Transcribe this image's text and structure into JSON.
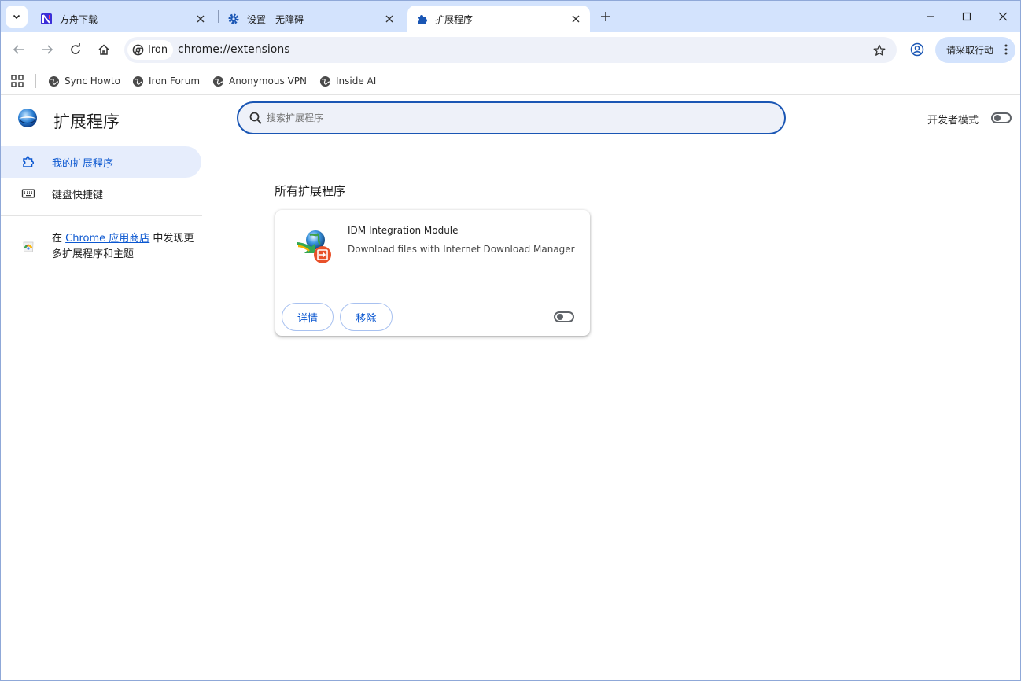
{
  "tabs": [
    {
      "title": "方舟下载",
      "icon": "site-logo-icon",
      "active": false
    },
    {
      "title": "设置 - 无障碍",
      "icon": "gear-icon",
      "active": false
    },
    {
      "title": "扩展程序",
      "icon": "puzzle-icon",
      "active": true
    }
  ],
  "toolbar": {
    "chip_label": "Iron",
    "url": "chrome://extensions",
    "action_label": "请采取行动"
  },
  "bookmarks": [
    {
      "label": "Sync Howto"
    },
    {
      "label": "Iron Forum"
    },
    {
      "label": "Anonymous VPN"
    },
    {
      "label": "Inside AI"
    }
  ],
  "page": {
    "title": "扩展程序",
    "search_placeholder": "搜索扩展程序",
    "devmode_label": "开发者模式",
    "devmode_enabled": false
  },
  "sidebar": {
    "items": [
      {
        "label": "我的扩展程序",
        "active": true
      },
      {
        "label": "键盘快捷键",
        "active": false
      }
    ],
    "store_prefix": "在 ",
    "store_link": "Chrome 应用商店",
    "store_suffix": " 中发现更多扩展程序和主题"
  },
  "main": {
    "section_title": "所有扩展程序",
    "extensions": [
      {
        "name": "IDM Integration Module",
        "description": "Download files with Internet Download Manager",
        "details_label": "详情",
        "remove_label": "移除",
        "enabled": false
      }
    ]
  },
  "colors": {
    "tabstrip": "#d3e3fd",
    "accent": "#0b57d0",
    "search_border": "#1a56b4"
  }
}
